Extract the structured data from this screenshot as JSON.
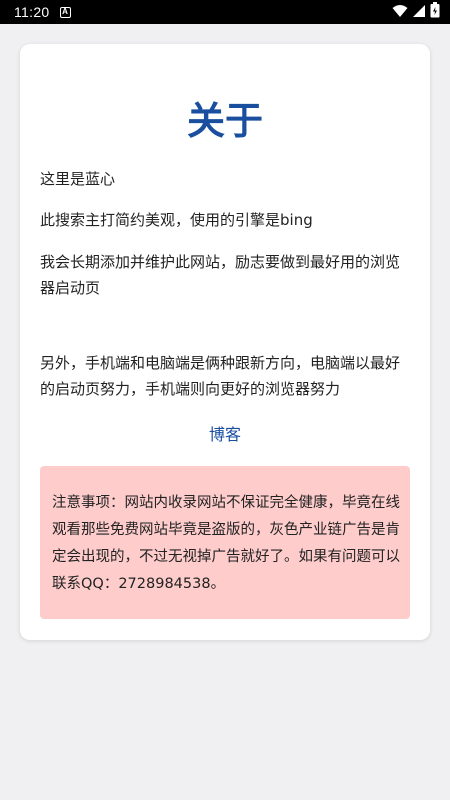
{
  "status_bar": {
    "time": "11:20",
    "notification_icon": "a-badge-icon",
    "icons": [
      "wifi-icon",
      "signal-icon",
      "battery-icon"
    ]
  },
  "about": {
    "title": "关于",
    "paragraphs": [
      "这里是蓝心",
      "此搜索主打简约美观，使用的引擎是bing",
      "我会长期添加并维护此网站，励志要做到最好用的浏览器启动页",
      "另外，手机端和电脑端是俩种跟新方向，电脑端以最好的启动页努力，手机端则向更好的浏览器努力"
    ],
    "blog_link": "博客",
    "notice": "注意事项：网站内收录网站不保证完全健康，毕竟在线观看那些免费网站毕竟是盗版的，灰色产业链广告是肯定会出现的，不过无视掉广告就好了。如果有问题可以联系QQ：2728984538。"
  },
  "colors": {
    "title": "#1a4fa0",
    "link": "#1a4fa0",
    "notice_background": "#ffcccc",
    "page_background": "#f0f0f2"
  }
}
